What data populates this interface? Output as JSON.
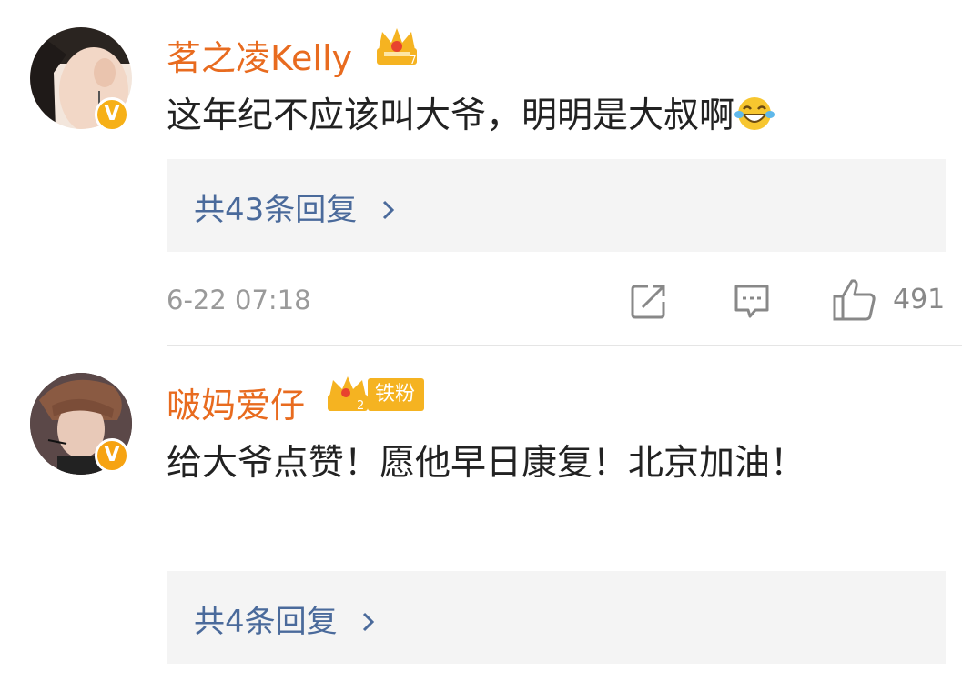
{
  "comments": [
    {
      "username": "茗之凌Kelly",
      "crown_level": "7",
      "text": "这年纪不应该叫大爷，明明是大叔啊",
      "emoji": "laughing-with-tears-emoji",
      "replies_label": "共43条回复",
      "timestamp": "6-22 07:18",
      "likes": "491",
      "verified_badge": "V"
    },
    {
      "username": "啵妈爱仔",
      "crown_level": "2",
      "fan_tag": "铁粉",
      "text": "给大爷点赞！愿他早日康复！北京加油！",
      "replies_label": "共4条回复",
      "verified_badge": "V"
    }
  ],
  "colors": {
    "username": "#e86b1f",
    "reply_link": "#4a6a9b",
    "crown": "#f5b321",
    "badge": "#f6b017"
  },
  "icons": [
    "share-icon",
    "comment-icon",
    "like-icon",
    "chevron-right-icon",
    "crown-icon"
  ]
}
